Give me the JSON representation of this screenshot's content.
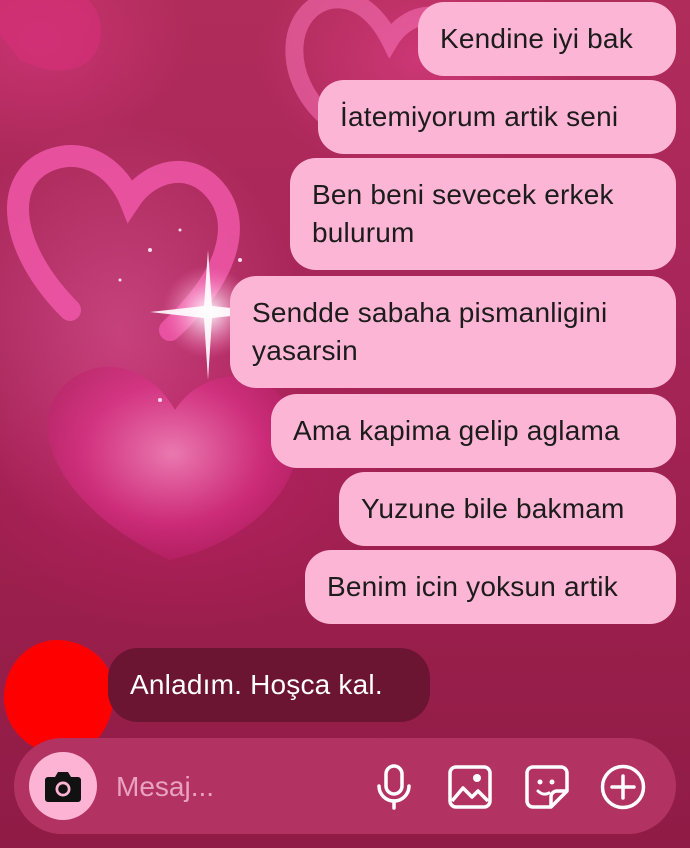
{
  "messages": {
    "outgoing": [
      {
        "lines": [
          "Kendine iyi bak"
        ]
      },
      {
        "lines": [
          "İatemiyorum artik seni"
        ]
      },
      {
        "lines": [
          "Ben beni sevecek erkek",
          "bulurum"
        ]
      },
      {
        "lines": [
          "Sendde sabaha pismanligini",
          "yasarsin"
        ]
      },
      {
        "lines": [
          "Ama kapima gelip aglama"
        ]
      },
      {
        "lines": [
          "Yuzune bile bakmam"
        ]
      },
      {
        "lines": [
          "Benim icin yoksun artik"
        ]
      }
    ],
    "incoming": [
      {
        "text": "Anladım. Hoşca kal."
      }
    ]
  },
  "composer": {
    "placeholder": "Mesaj...",
    "icons": [
      "camera-icon",
      "microphone-icon",
      "image-icon",
      "sticker-icon",
      "add-icon"
    ]
  },
  "colors": {
    "outgoing_bubble": "#fdb5d5",
    "incoming_bubble": "#6b1532",
    "composer_bg": "#b23261",
    "icon_color": "#ffffff",
    "avatar_redaction": "#ff0000"
  }
}
